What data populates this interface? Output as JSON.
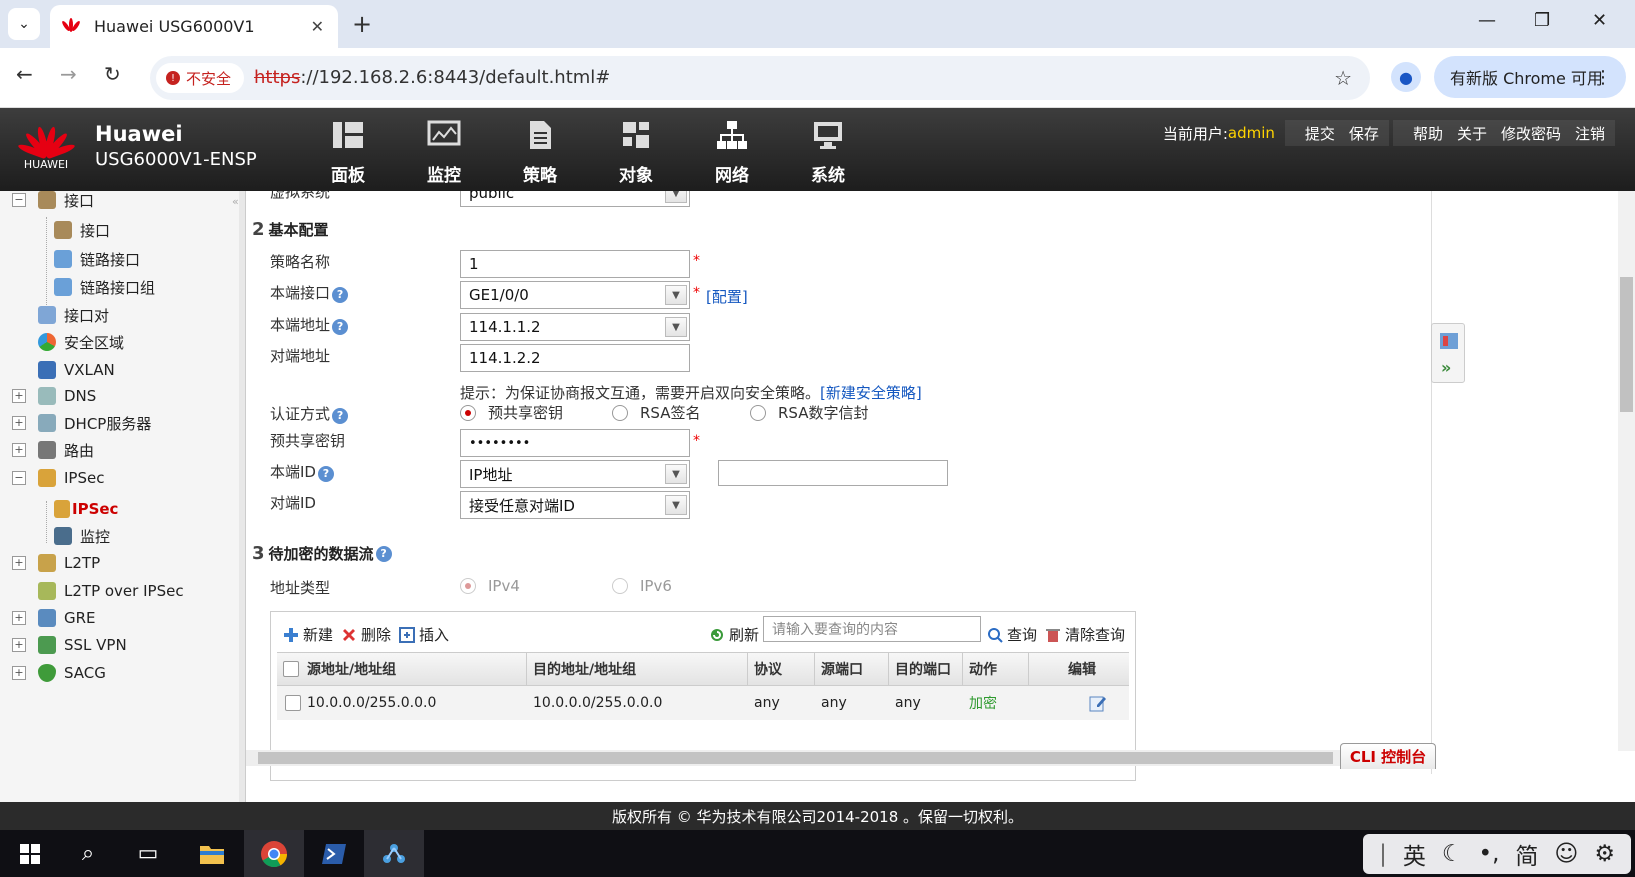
{
  "browser": {
    "tab_title": "Huawei USG6000V1",
    "insecure_label": "不安全",
    "url_scheme": "https",
    "url_rest": "://192.168.2.6:8443/default.html#",
    "update_label": "有新版 Chrome 可用"
  },
  "header": {
    "brand": "HUAWEI",
    "product_line1": "Huawei",
    "product_line2": "USG6000V1-ENSP",
    "nav": [
      "面板",
      "监控",
      "策略",
      "对象",
      "网络",
      "系统"
    ],
    "current_user_label": "当前用户:",
    "current_user": "admin",
    "actions": [
      "提交",
      "保存",
      "帮助",
      "关于",
      "修改密码",
      "注销"
    ]
  },
  "sidebar": {
    "items": [
      {
        "label": "接口",
        "expander": "−"
      },
      {
        "label": "接口"
      },
      {
        "label": "链路接口"
      },
      {
        "label": "链路接口组"
      },
      {
        "label": "接口对"
      },
      {
        "label": "安全区域"
      },
      {
        "label": "VXLAN"
      },
      {
        "label": "DNS",
        "expander": "+"
      },
      {
        "label": "DHCP服务器",
        "expander": "+"
      },
      {
        "label": "路由",
        "expander": "+"
      },
      {
        "label": "IPSec",
        "expander": "−"
      },
      {
        "label": "IPSec",
        "selected": true
      },
      {
        "label": "监控"
      },
      {
        "label": "L2TP",
        "expander": "+"
      },
      {
        "label": "L2TP over IPSec"
      },
      {
        "label": "GRE",
        "expander": "+"
      },
      {
        "label": "SSL VPN",
        "expander": "+"
      },
      {
        "label": "SACG",
        "expander": "+"
      }
    ]
  },
  "form": {
    "vsys_label": "虚拟系统",
    "vsys_value": "public",
    "section2_num": "2",
    "section2_title": "基本配置",
    "policy_name_label": "策略名称",
    "policy_name_value": "1",
    "local_if_label": "本端接口",
    "local_if_value": "GE1/0/0",
    "config_link": "[配置]",
    "local_addr_label": "本端地址",
    "local_addr_value": "114.1.1.2",
    "peer_addr_label": "对端地址",
    "peer_addr_value": "114.1.2.2",
    "hint_text": "提示：为保证协商报文互通，需要开启双向安全策略。",
    "hint_link": "[新建安全策略]",
    "auth_label": "认证方式",
    "auth_options": [
      "预共享密钥",
      "RSA签名",
      "RSA数字信封"
    ],
    "psk_label": "预共享密钥",
    "psk_value": "••••••••",
    "local_id_label": "本端ID",
    "local_id_value": "IP地址",
    "local_id_extra": "",
    "peer_id_label": "对端ID",
    "peer_id_value": "接受任意对端ID",
    "required_mark": "*",
    "help_mark": "?",
    "section3_num": "3",
    "section3_title": "待加密的数据流",
    "addr_type_label": "地址类型",
    "addr_type_options": [
      "IPv4",
      "IPv6"
    ]
  },
  "table": {
    "toolbar": {
      "new": "新建",
      "delete": "删除",
      "insert": "插入",
      "refresh": "刷新",
      "search_placeholder": "请输入要查询的内容",
      "query": "查询",
      "clear_query": "清除查询"
    },
    "headers": [
      "源地址/地址组",
      "目的地址/地址组",
      "协议",
      "源端口",
      "目的端口",
      "动作",
      "编辑"
    ],
    "rows": [
      {
        "src": "10.0.0.0/255.0.0.0",
        "dst": "10.0.0.0/255.0.0.0",
        "proto": "any",
        "sport": "any",
        "dport": "any",
        "action": "加密"
      }
    ]
  },
  "cli_label": "CLI 控制台",
  "footer": "版权所有 © 华为技术有限公司2014-2018 。保留一切权利。",
  "taskbar": {
    "ime": [
      "英",
      "简"
    ]
  },
  "colors": {
    "brand_red": "#e60012",
    "user_yellow": "#ffd400",
    "link_blue": "#1558c0",
    "action_green": "#2e9a2e"
  }
}
